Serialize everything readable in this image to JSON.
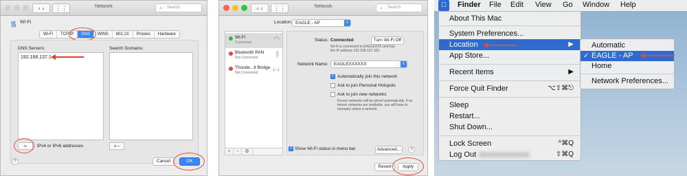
{
  "dns_window": {
    "title": "Network",
    "search_placeholder": "Search",
    "service_name": "Wi-Fi",
    "tabs": [
      "Wi-Fi",
      "TCP/IP",
      "DNS",
      "WINS",
      "802.1X",
      "Proxies",
      "Hardware"
    ],
    "active_tab": "DNS",
    "dns_servers_label": "DNS Servers:",
    "dns_server_entry": "192.168.137.1",
    "search_domains_label": "Search Domains:",
    "address_hint": "IPv4 or IPv6 addresses",
    "add_symbol": "+",
    "remove_symbol": "−",
    "help": "?",
    "cancel": "Cancel",
    "ok": "OK"
  },
  "network_window": {
    "title": "Network",
    "search_placeholder": "Search",
    "location_label": "Location:",
    "location_value": "EAGLE - AP",
    "services": [
      {
        "name": "Wi-Fi",
        "status": "Connected",
        "dot": "#35b54a"
      },
      {
        "name": "Bluetooth PAN",
        "status": "Not Connected",
        "dot": "#e0463c"
      },
      {
        "name": "Thunde...lt Bridge",
        "status": "Not Connected",
        "dot": "#e0463c"
      }
    ],
    "status_label": "Status:",
    "status_value": "Connected",
    "turn_off": "Turn Wi-Fi Off",
    "status_desc": "Wi-Fi is connected to EAGLEXXX and has the IP address 192.168.137.102.",
    "network_name_label": "Network Name:",
    "network_name_value": "EAGLEXXXXXX",
    "auto_join": "Automatically join this network",
    "ask_hotspots": "Ask to join Personal Hotspots",
    "ask_new": "Ask to join new networks",
    "ask_new_desc": "Known networks will be joined automatically. If no known networks are available, you will have to manually select a network.",
    "show_wifi": "Show Wi-Fi status in menu bar",
    "advanced": "Advanced...",
    "help": "?",
    "revert": "Revert",
    "apply": "Apply"
  },
  "apple_menu": {
    "menubar": [
      "Finder",
      "File",
      "Edit",
      "View",
      "Go",
      "Window",
      "Help"
    ],
    "items": {
      "about": "About This Mac",
      "system_prefs": "System Preferences...",
      "location": "Location",
      "app_store": "App Store...",
      "recent_items": "Recent Items",
      "force_quit": "Force Quit Finder",
      "force_quit_shortcut": "⌥⇧⌘⎋",
      "sleep": "Sleep",
      "restart": "Restart...",
      "shut_down": "Shut Down...",
      "lock_screen": "Lock Screen",
      "lock_shortcut": "^⌘Q",
      "log_out": "Log Out",
      "log_out_shortcut": "⇧⌘Q"
    },
    "location_submenu": {
      "automatic": "Automatic",
      "eagle": "EAGLE - AP",
      "home": "Home",
      "network_prefs": "Network Preferences..."
    }
  }
}
